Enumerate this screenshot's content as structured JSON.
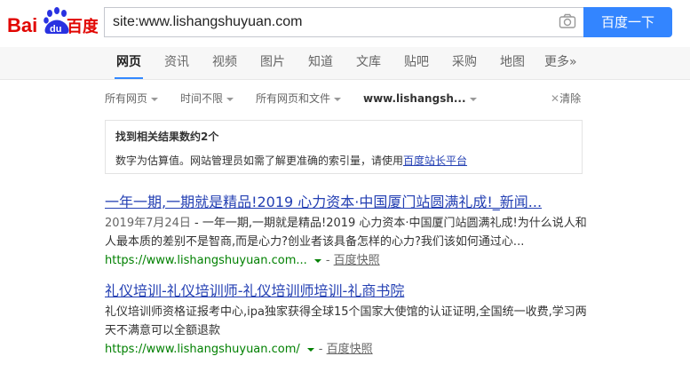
{
  "logo": {
    "text_left": "Bai",
    "text_paw": "du",
    "text_right": "百度"
  },
  "search": {
    "query": "site:www.lishangshuyuan.com",
    "button_label": "百度一下"
  },
  "nav": {
    "items": [
      {
        "label": "网页",
        "active": true
      },
      {
        "label": "资讯"
      },
      {
        "label": "视频"
      },
      {
        "label": "图片"
      },
      {
        "label": "知道"
      },
      {
        "label": "文库"
      },
      {
        "label": "贴吧"
      },
      {
        "label": "采购"
      },
      {
        "label": "地图"
      },
      {
        "label": "更多»"
      }
    ]
  },
  "filters": {
    "pages": "所有网页",
    "time": "时间不限",
    "filetype": "所有网页和文件",
    "site": "www.lishangsh...",
    "clear": "清除"
  },
  "info": {
    "title": "找到相关结果数约2个",
    "desc": "数字为估算值。网站管理员如需了解更准确的索引量，请使用",
    "link": "百度站长平台"
  },
  "results": [
    {
      "title": "一年一期,一期就是精品!2019 心力资本·中国厦门站圆满礼成!_新闻...",
      "date": "2019年7月24日",
      "abstract_line1": " - 一年一期,一期就是精品!2019 心力资本·中国厦门站圆满礼成!为什么说人和",
      "abstract_line2": "人最本质的差别不是智商,而是心力?创业者该具备怎样的心力?我们该如何通过心...",
      "url": "https://www.lishangshuyuan.com...",
      "snapshot": "百度快照"
    },
    {
      "title": "礼仪培训-礼仪培训师-礼仪培训师培训-礼商书院",
      "abstract_line1": "礼仪培训师资格证报考中心,ipa独家获得全球15个国家大使馆的认证证明,全国统一收费,学习两",
      "abstract_line2": "天不满意可以全额退款",
      "url": "https://www.lishangshuyuan.com/",
      "snapshot": "百度快照"
    }
  ],
  "colors": {
    "accent": "#3385ff",
    "link": "#2440b3",
    "url": "#008000",
    "logo_red": "#e10602",
    "logo_blue": "#2932e1"
  }
}
